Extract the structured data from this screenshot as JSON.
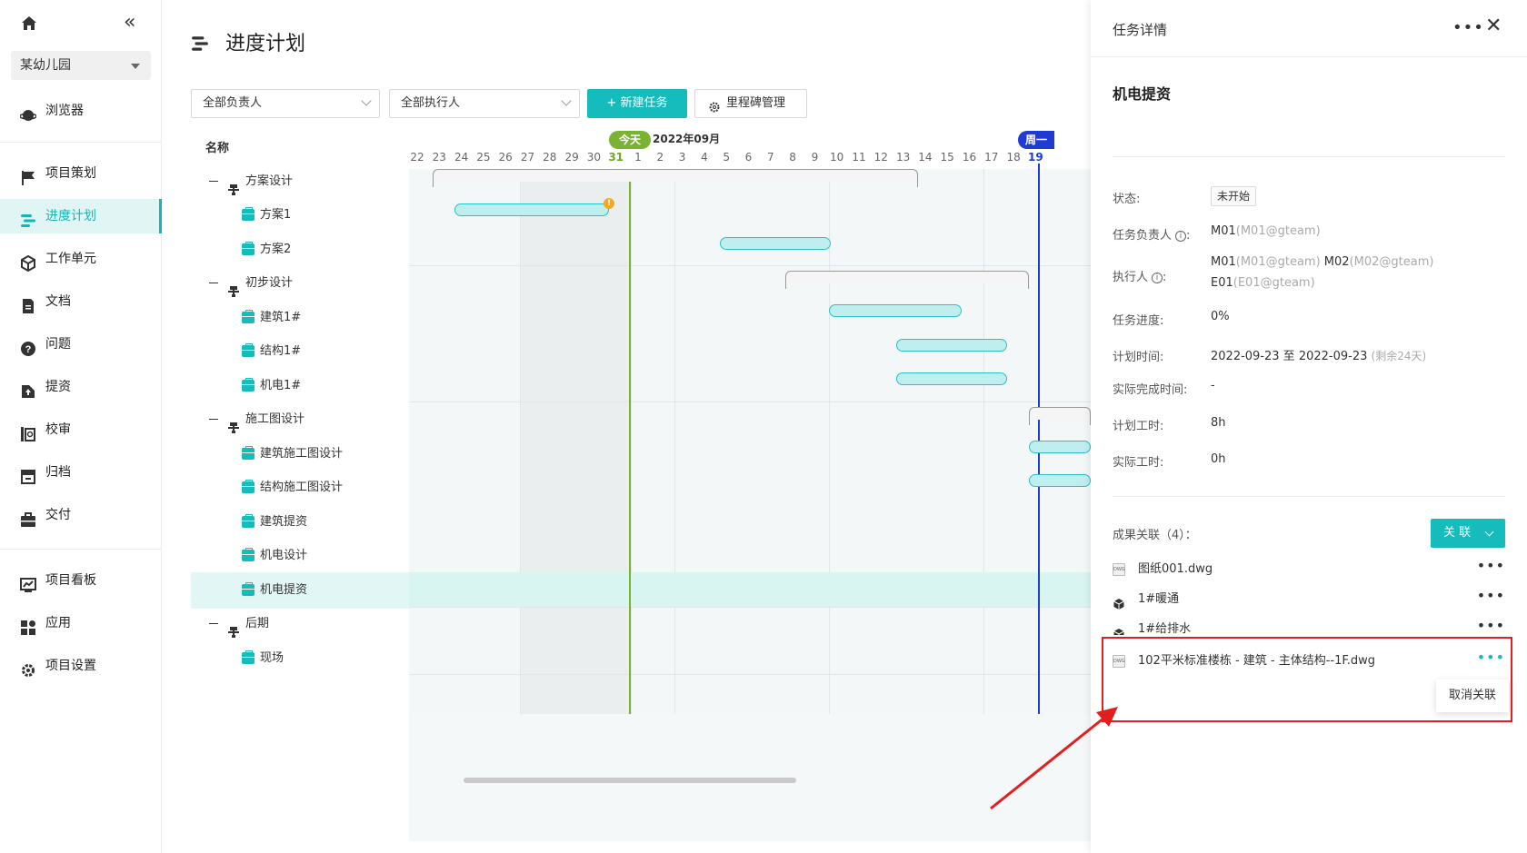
{
  "sidebar": {
    "project": "某幼儿园",
    "items": [
      {
        "label": "浏览器",
        "icon": "planet-icon"
      },
      {
        "label": "项目策划",
        "icon": "flag-icon"
      },
      {
        "label": "进度计划",
        "icon": "gantt-icon",
        "active": true
      },
      {
        "label": "工作单元",
        "icon": "cube-icon"
      },
      {
        "label": "文档",
        "icon": "document-icon"
      },
      {
        "label": "问题",
        "icon": "question-icon"
      },
      {
        "label": "提资",
        "icon": "upload-icon"
      },
      {
        "label": "校审",
        "icon": "review-icon"
      },
      {
        "label": "归档",
        "icon": "archive-icon"
      },
      {
        "label": "交付",
        "icon": "briefcase-icon"
      },
      {
        "label": "项目看板",
        "icon": "dashboard-icon"
      },
      {
        "label": "应用",
        "icon": "apps-icon"
      },
      {
        "label": "项目设置",
        "icon": "gear-icon"
      }
    ]
  },
  "main": {
    "title": "进度计划",
    "filters": {
      "owner": "全部负责人",
      "executor": "全部执行人"
    },
    "new_task": "+ 新建任务",
    "milestone": "里程碑管理",
    "column_name": "名称"
  },
  "tree": [
    {
      "label": "方案设计",
      "type": "group"
    },
    {
      "label": "方案1",
      "type": "task"
    },
    {
      "label": "方案2",
      "type": "task"
    },
    {
      "label": "初步设计",
      "type": "group"
    },
    {
      "label": "建筑1#",
      "type": "task"
    },
    {
      "label": "结构1#",
      "type": "task"
    },
    {
      "label": "机电1#",
      "type": "task"
    },
    {
      "label": "施工图设计",
      "type": "group"
    },
    {
      "label": "建筑施工图设计",
      "type": "task"
    },
    {
      "label": "结构施工图设计",
      "type": "task"
    },
    {
      "label": "建筑提资",
      "type": "task"
    },
    {
      "label": "机电设计",
      "type": "task"
    },
    {
      "label": "机电提资",
      "type": "task",
      "selected": true
    },
    {
      "label": "后期",
      "type": "group"
    },
    {
      "label": "现场",
      "type": "task"
    }
  ],
  "gantt": {
    "month": "2022年09月",
    "today_label": "今天",
    "today_day": "31",
    "marker_label": "周一",
    "marker_day": "19",
    "days": [
      "22",
      "23",
      "24",
      "25",
      "26",
      "27",
      "28",
      "29",
      "30",
      "31",
      "1",
      "2",
      "3",
      "4",
      "5",
      "6",
      "7",
      "8",
      "9",
      "10",
      "11",
      "12",
      "13",
      "14",
      "15",
      "16",
      "17",
      "18",
      "19"
    ],
    "warning_badge": "!"
  },
  "panel": {
    "title": "任务详情",
    "task_name": "机电提资",
    "status_label": "状态:",
    "status_value": "未开始",
    "owner_label": "任务负责人",
    "owner_name": "M01",
    "owner_sub": "(M01@gteam)",
    "executor_label": "执行人",
    "executors": [
      {
        "name": "M01",
        "sub": "(M01@gteam)"
      },
      {
        "name": "M02",
        "sub": "(M02@gteam)"
      },
      {
        "name": "E01",
        "sub": "(E01@gteam)"
      }
    ],
    "progress_label": "任务进度:",
    "progress_value": "0%",
    "plan_label": "计划时间:",
    "plan_value": "2022-09-23 至 2022-09-23",
    "plan_remaining": "(剩余24天)",
    "actual_finish_label": "实际完成时间:",
    "actual_finish_value": "-",
    "plan_hours_label": "计划工时:",
    "plan_hours_value": "8h",
    "actual_hours_label": "实际工时:",
    "actual_hours_value": "0h",
    "results_label": "成果关联（4）：",
    "link_button": "关 联",
    "results": [
      {
        "name": "图纸001.dwg",
        "icon": "dwg-icon"
      },
      {
        "name": "1#暖通",
        "icon": "cube-icon"
      },
      {
        "name": "1#给排水",
        "icon": "cube-icon"
      },
      {
        "name": "102平米标准楼栋 - 建筑 - 主体结构--1F.dwg",
        "icon": "dwg-icon"
      }
    ],
    "popup_unlink": "取消关联"
  }
}
